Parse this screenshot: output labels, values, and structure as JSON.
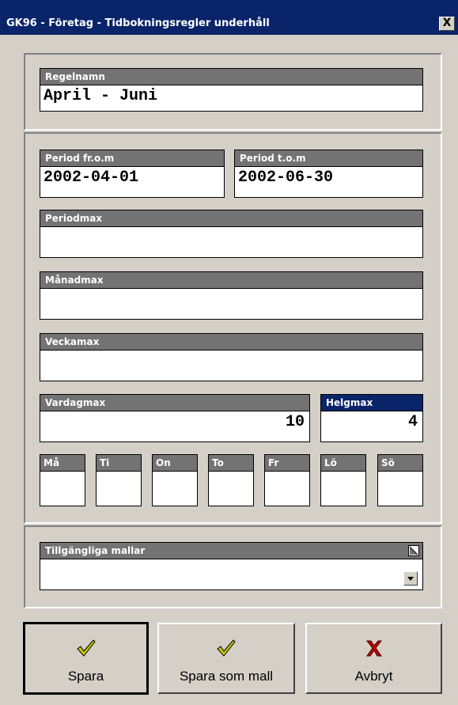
{
  "window": {
    "title": "GK96 - Företag - Tidbokningsregler underhåll",
    "close_label": "X"
  },
  "rule": {
    "name_label": "Regelnamn",
    "name_value": "April - Juni"
  },
  "period": {
    "from_label": "Period fr.o.m",
    "from_value": "2002-04-01",
    "to_label": "Period t.o.m",
    "to_value": "2002-06-30"
  },
  "limits": {
    "periodmax_label": "Periodmax",
    "periodmax_value": "",
    "manadmax_label": "Månadmax",
    "manadmax_value": "",
    "veckamax_label": "Veckamax",
    "veckamax_value": "",
    "vardagmax_label": "Vardagmax",
    "vardagmax_value": "10",
    "helgmax_label": "Helgmax",
    "helgmax_value": "4"
  },
  "days": [
    {
      "label": "Må",
      "value": ""
    },
    {
      "label": "Ti",
      "value": ""
    },
    {
      "label": "On",
      "value": ""
    },
    {
      "label": "To",
      "value": ""
    },
    {
      "label": "Fr",
      "value": ""
    },
    {
      "label": "Lö",
      "value": ""
    },
    {
      "label": "Sö",
      "value": ""
    }
  ],
  "templates": {
    "label": "Tillgängliga mallar",
    "selected": ""
  },
  "buttons": {
    "save": "Spara",
    "save_template": "Spara som mall",
    "cancel": "Avbryt"
  },
  "icons": {
    "save": "checkmark-icon",
    "save_template": "checkmark-icon",
    "cancel": "x-icon"
  },
  "colors": {
    "titlebar": "#0a246a",
    "label_bg": "#737373",
    "active_label_bg": "#0a246a",
    "face": "#d4d0c8",
    "check": "#c8c800",
    "cancel": "#c00000"
  }
}
